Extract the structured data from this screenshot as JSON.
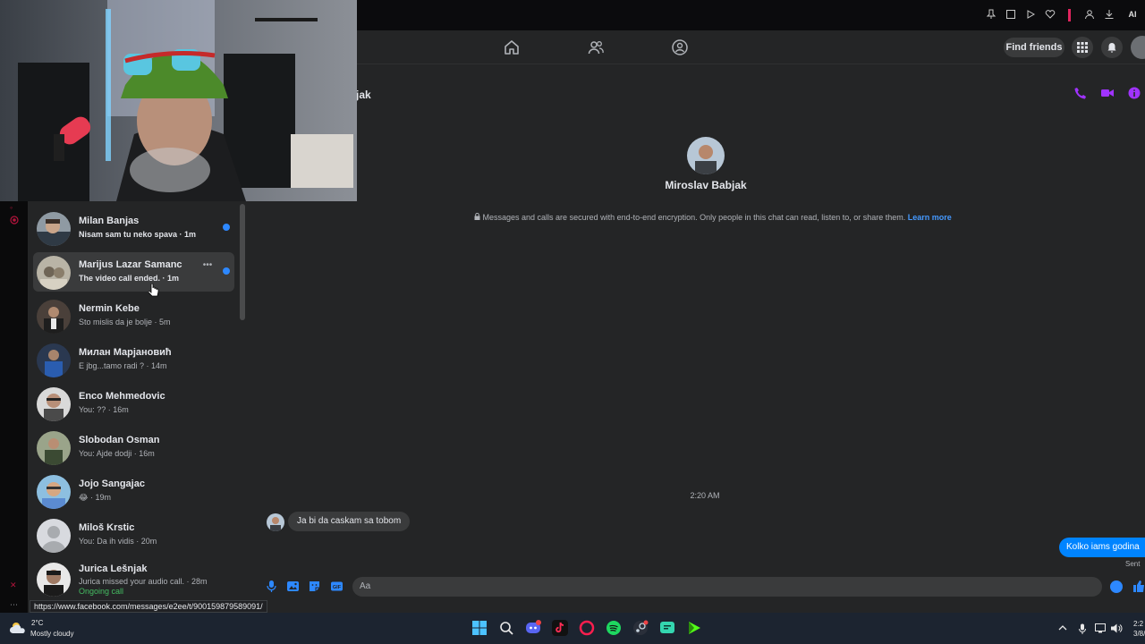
{
  "browser": {
    "icon_names": [
      "pin-icon",
      "tab-icon",
      "play-icon",
      "heart-icon",
      "profile-icon",
      "download-icon",
      "extension-icon"
    ],
    "ext_label": "AI"
  },
  "header": {
    "nav_icons": [
      "home-icon",
      "friends-icon",
      "groups-icon"
    ],
    "find_friends_label": "Find friends"
  },
  "chat_list": [
    {
      "name": "Milan Banjas",
      "preview": "Nisam sam tu neko spava · 1m",
      "unread": true,
      "active": false
    },
    {
      "name": "Marijus Lazar Samanc",
      "preview": "The video call ended. · 1m",
      "unread": true,
      "active": true
    },
    {
      "name": "Nermin Kebe",
      "preview": "Sto mislis da je bolje · 5m",
      "unread": false,
      "active": false
    },
    {
      "name": "Милан Марјановић",
      "preview": "E jbg...tamo radi ? · 14m",
      "unread": false,
      "active": false
    },
    {
      "name": "Enco Mehmedovic",
      "preview": "You: ?? · 16m",
      "unread": false,
      "active": false
    },
    {
      "name": "Slobodan Osman",
      "preview": "You: Ajde dodji · 16m",
      "unread": false,
      "active": false
    },
    {
      "name": "Jojo Sangajac",
      "preview": "😂 · 19m",
      "unread": false,
      "active": false
    },
    {
      "name": "Miloš Krstic",
      "preview": "You: Da ih vidis · 20m",
      "unread": false,
      "active": false
    },
    {
      "name": "Jurica Lešnjak",
      "preview": "Jurica missed your audio call. · 28m",
      "extra": "Ongoing call",
      "unread": false,
      "active": false
    }
  ],
  "conversation": {
    "title_fragment": "jak",
    "contact_name": "Miroslav Babjak",
    "encryption_text": "Messages and calls are secured with end-to-end encryption. Only people in this chat can read, listen to, or share them.",
    "learn_more": "Learn more",
    "timestamp": "2:20 AM",
    "incoming_message": "Ja bi da caskam sa tobom",
    "outgoing_message": "Kolko iams godina",
    "sent_label": "Sent",
    "composer_placeholder": "Aa"
  },
  "status_url": "https://www.facebook.com/messages/e2ee/t/900159879589091/",
  "taskbar": {
    "temperature": "2°C",
    "weather": "Mostly cloudy",
    "clock_time": "2:2",
    "clock_date": "3/8/"
  },
  "colors": {
    "accent": "#0084ff",
    "call_icons": "#a033ff",
    "online": "#45bd62"
  }
}
